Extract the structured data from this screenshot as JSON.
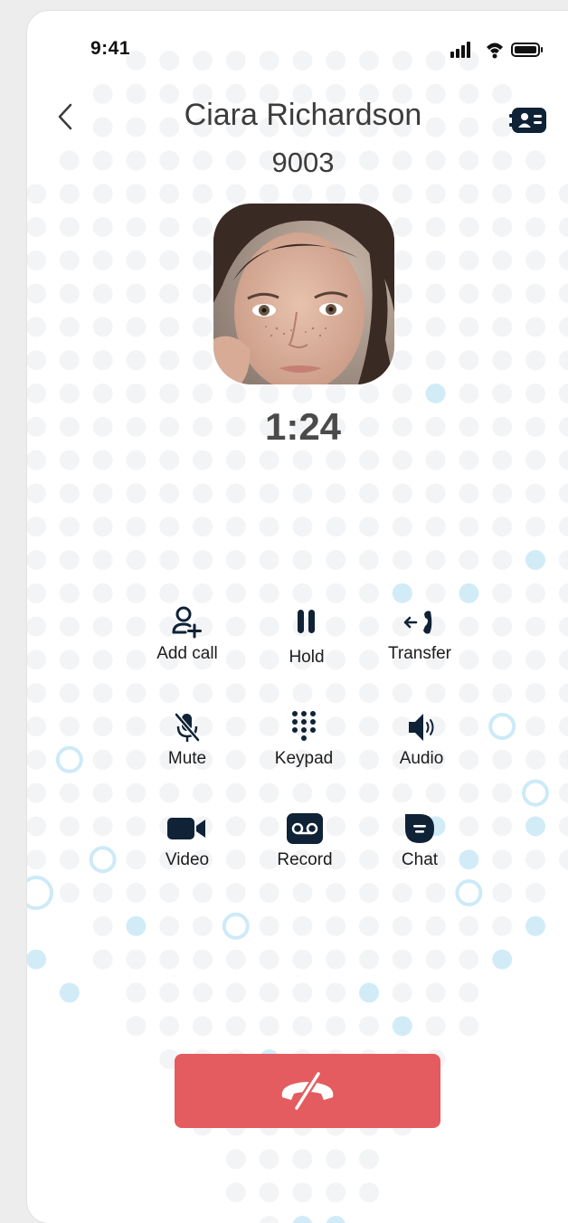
{
  "status_bar": {
    "time": "9:41",
    "icons": [
      "signal-icon",
      "wifi-icon",
      "battery-icon"
    ]
  },
  "header": {
    "name": "Ciara Richardson",
    "number": "9003"
  },
  "call": {
    "duration": "1:24"
  },
  "controls": [
    {
      "id": "add-call",
      "label": "Add call",
      "icon": "add-person-icon"
    },
    {
      "id": "hold",
      "label": "Hold",
      "icon": "pause-icon"
    },
    {
      "id": "transfer",
      "label": "Transfer",
      "icon": "transfer-icon"
    },
    {
      "id": "mute",
      "label": "Mute",
      "icon": "mic-off-icon"
    },
    {
      "id": "keypad",
      "label": "Keypad",
      "icon": "keypad-icon"
    },
    {
      "id": "audio",
      "label": "Audio",
      "icon": "speaker-icon"
    },
    {
      "id": "video",
      "label": "Video",
      "icon": "video-camera-icon"
    },
    {
      "id": "record",
      "label": "Record",
      "icon": "voicemail-icon"
    },
    {
      "id": "chat",
      "label": "Chat",
      "icon": "chat-bubble-icon"
    }
  ],
  "colors": {
    "accent_dark": "#0f2236",
    "end_call": "#e45c5f",
    "dot": "#f3f4f6",
    "dot_accent": "#d2ecf7"
  }
}
